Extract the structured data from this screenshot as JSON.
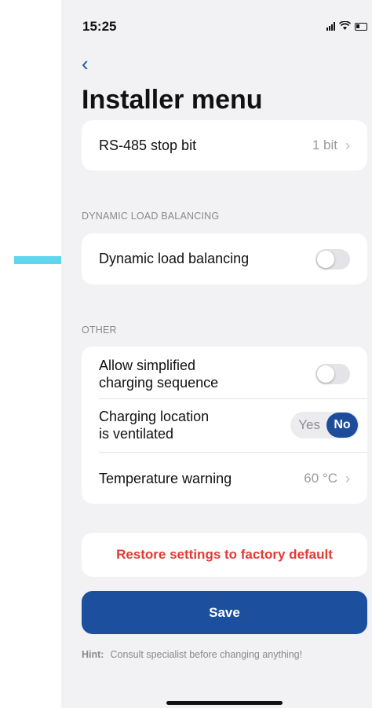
{
  "status_bar": {
    "time": "15:25"
  },
  "nav": {
    "back_glyph": "‹",
    "title": "Installer menu"
  },
  "rs485": {
    "label": "RS-485 stop bit",
    "value": "1 bit"
  },
  "dlb_section": {
    "header": "DYNAMIC LOAD BALANCING",
    "item": {
      "label": "Dynamic load balancing",
      "toggle_on": false
    }
  },
  "other_section": {
    "header": "OTHER",
    "simplified": {
      "label_line1": "Allow simplified",
      "label_line2": "charging sequence",
      "toggle_on": false
    },
    "ventilated": {
      "label_line1": "Charging location",
      "label_line2": "is ventilated",
      "yes": "Yes",
      "no": "No",
      "selected": "No"
    },
    "temperature": {
      "label": "Temperature warning",
      "value": "60 °C"
    }
  },
  "restore_label": "Restore settings to factory default",
  "save_label": "Save",
  "hint": {
    "prefix": "Hint:",
    "text": "Consult specialist before changing anything!"
  },
  "colors": {
    "accent": "#1c4f9e",
    "danger": "#e23b34",
    "arrow": "#5fd6ee"
  },
  "icons": [
    "cellular-signal-icon",
    "wifi-icon",
    "battery-icon",
    "back-chevron-icon",
    "chevron-right-icon",
    "pointer-arrow-icon"
  ]
}
